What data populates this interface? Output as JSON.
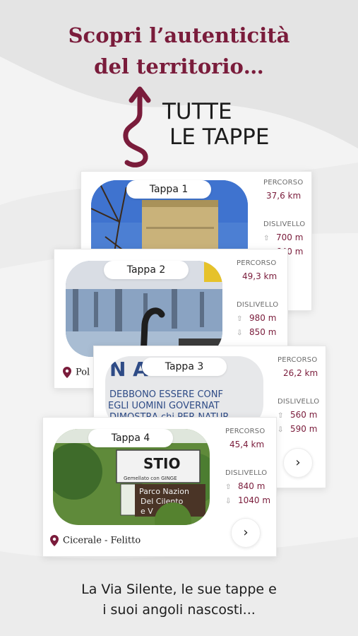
{
  "headline": {
    "line1": "Scopri l’autenticità",
    "line2": "del territorio…"
  },
  "section": {
    "line1": "TUTTE",
    "line2": "LE TAPPE"
  },
  "labels": {
    "percorso": "PERCORSO",
    "dislivello": "DISLIVELLO"
  },
  "stages": [
    {
      "title": "Tappa 1",
      "distance": "37,6 km",
      "up": "700 m",
      "down": "640 m",
      "location": ""
    },
    {
      "title": "Tappa 2",
      "distance": "49,3 km",
      "up": "980 m",
      "down": "850 m",
      "location": "Pol"
    },
    {
      "title": "Tappa 3",
      "distance": "26,2 km",
      "up": "560 m",
      "down": "590 m",
      "location": ""
    },
    {
      "title": "Tappa 4",
      "distance": "45,4 km",
      "up": "840 m",
      "down": "1040 m",
      "location": "Cicerale - Felitto"
    }
  ],
  "photo_text": {
    "tappa3": {
      "l0": "N    A",
      "l1": "DEBBONO ESSERE CONF",
      "l2": "EGLI UOMINI GOVERNAT",
      "l3": "DIMOSTRA chi PER NATUR"
    },
    "tappa4": {
      "sign": "STIO",
      "small": "Gemellato con  GINGE",
      "park1": "Parco Nazion",
      "park2": "Del Cilento",
      "park3": "e V"
    }
  },
  "footer": {
    "line1": "La Via Silente, le sue tappe e",
    "line2": "i suoi angoli nascosti..."
  },
  "colors": {
    "accent": "#7a1c3b",
    "text": "#1c1c1c",
    "muted": "#6b6b6b"
  },
  "icons": {
    "up": "arrow-up-icon",
    "down": "arrow-down-icon",
    "next": "chevron-right-icon",
    "pin": "location-pin-icon"
  }
}
